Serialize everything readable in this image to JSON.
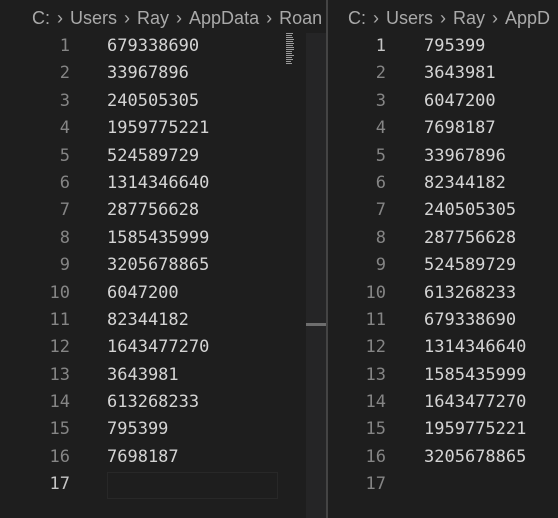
{
  "left_editor": {
    "breadcrumb": [
      "C:",
      "Users",
      "Ray",
      "AppData",
      "Roan"
    ],
    "lines": [
      {
        "n": "1",
        "text": "679338690"
      },
      {
        "n": "2",
        "text": "33967896"
      },
      {
        "n": "3",
        "text": "240505305"
      },
      {
        "n": "4",
        "text": "1959775221"
      },
      {
        "n": "5",
        "text": "524589729"
      },
      {
        "n": "6",
        "text": "1314346640"
      },
      {
        "n": "7",
        "text": "287756628"
      },
      {
        "n": "8",
        "text": "1585435999"
      },
      {
        "n": "9",
        "text": "3205678865"
      },
      {
        "n": "10",
        "text": "6047200"
      },
      {
        "n": "11",
        "text": "82344182"
      },
      {
        "n": "12",
        "text": "1643477270"
      },
      {
        "n": "13",
        "text": "3643981"
      },
      {
        "n": "14",
        "text": "613268233"
      },
      {
        "n": "15",
        "text": "795399"
      },
      {
        "n": "16",
        "text": "7698187"
      },
      {
        "n": "17",
        "text": ""
      }
    ],
    "active_line": "17"
  },
  "right_editor": {
    "breadcrumb": [
      "C:",
      "Users",
      "Ray",
      "AppD"
    ],
    "lines": [
      {
        "n": "1",
        "text": "795399"
      },
      {
        "n": "2",
        "text": "3643981"
      },
      {
        "n": "3",
        "text": "6047200"
      },
      {
        "n": "4",
        "text": "7698187"
      },
      {
        "n": "5",
        "text": "33967896"
      },
      {
        "n": "6",
        "text": "82344182"
      },
      {
        "n": "7",
        "text": "240505305"
      },
      {
        "n": "8",
        "text": "287756628"
      },
      {
        "n": "9",
        "text": "524589729"
      },
      {
        "n": "10",
        "text": "613268233"
      },
      {
        "n": "11",
        "text": "679338690"
      },
      {
        "n": "12",
        "text": "1314346640"
      },
      {
        "n": "13",
        "text": "1585435999"
      },
      {
        "n": "14",
        "text": "1643477270"
      },
      {
        "n": "15",
        "text": "1959775221"
      },
      {
        "n": "16",
        "text": "3205678865"
      },
      {
        "n": "17",
        "text": ""
      }
    ],
    "active_line": "1"
  },
  "colors": {
    "background": "#1e1e1e",
    "line_number": "#858585",
    "active_line_number": "#c6c6c6",
    "text": "#d4d4d4",
    "breadcrumb": "#a9a9a9"
  }
}
